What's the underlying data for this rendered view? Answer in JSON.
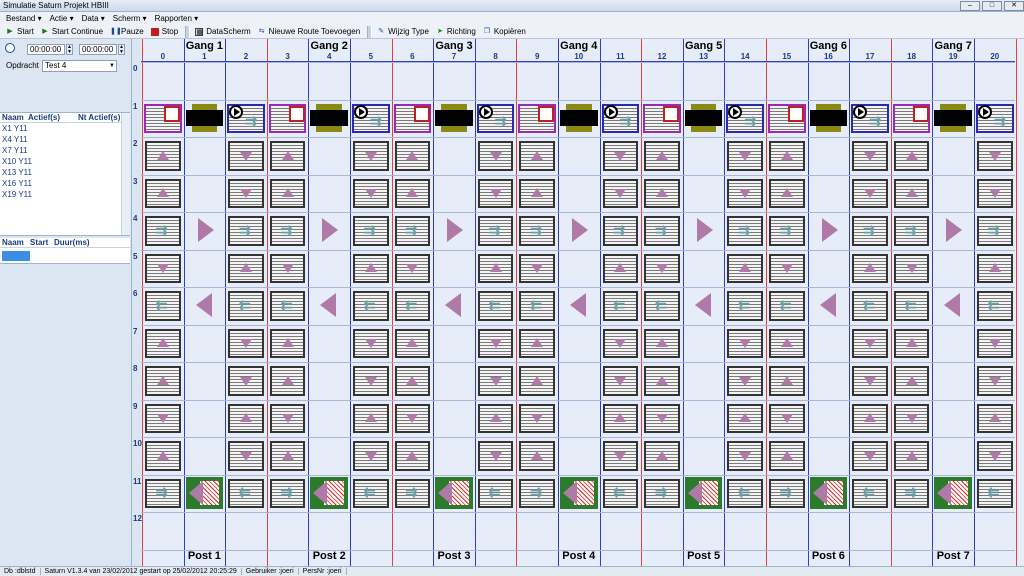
{
  "window": {
    "title": "Simulatie Saturn Projekt HBIII"
  },
  "menu": [
    "Bestand ▾",
    "Actie ▾",
    "Data ▾",
    "Scherm ▾",
    "Rapporten ▾"
  ],
  "toolbar": {
    "start": "Start",
    "start_continue": "Start Continue",
    "pauze": "Pauze",
    "stop": "Stop",
    "datascherm": "DataScherm",
    "nieuwe_route": "Nieuwe Route Toevoegen",
    "wijzig_type": "Wijzig Type",
    "richting": "Richting",
    "kopieren": "Kopiëren"
  },
  "left": {
    "time1": "00:00:00",
    "time2": "00:00:00",
    "opdracht_label": "Opdracht",
    "opdracht_value": "Test 4",
    "agv_headers": [
      "Naam",
      "Actief(s)",
      "Nt Actief(s)"
    ],
    "agvs": [
      "X1 Y11",
      "X4 Y11",
      "X7 Y11",
      "X10 Y11",
      "X13 Y11",
      "X16 Y11",
      "X19 Y11"
    ],
    "route_headers": [
      "Naam",
      "Start",
      "Duur(ms)"
    ]
  },
  "grid": {
    "gangs": [
      "Gang 1",
      "Gang 2",
      "Gang 3",
      "Gang 4",
      "Gang 5",
      "Gang 6",
      "Gang 7"
    ],
    "posts": [
      "Post 1",
      "Post 2",
      "Post 3",
      "Post 4",
      "Post 5",
      "Post 6",
      "Post 7"
    ],
    "columns": [
      "0",
      "1",
      "2",
      "3",
      "4",
      "5",
      "6",
      "7",
      "8",
      "9",
      "10",
      "11",
      "12",
      "13",
      "14",
      "15",
      "16",
      "17",
      "18",
      "19",
      "20"
    ],
    "rows": [
      "0",
      "1",
      "2",
      "3",
      "4",
      "5",
      "6",
      "7",
      "8",
      "9",
      "10",
      "11",
      "12"
    ]
  },
  "status": {
    "db": "Db :dblstd",
    "version": "Saturn V1.3.4 van 23/02/2012 gestart op 25/02/2012 20:25:29",
    "user": "Gebruiker :joeri",
    "pers": "PersNr :joeri"
  },
  "colors": {
    "gang_border": "#e04040",
    "col_border": "#3040c0",
    "arrow": "#b07aa8",
    "post": "#2c7a2c"
  }
}
